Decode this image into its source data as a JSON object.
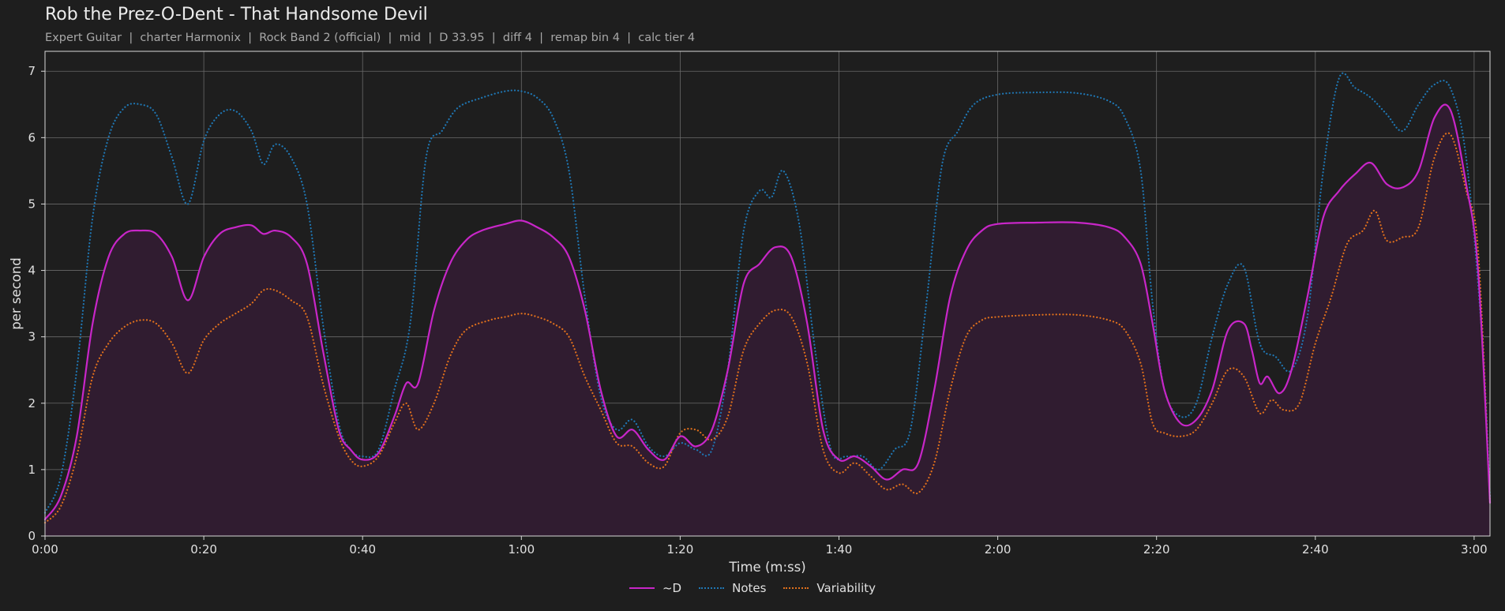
{
  "header": {
    "title": "Rob the Prez-O-Dent - That Handsome Devil",
    "subtitle": "Expert Guitar  |  charter Harmonix  |  Rock Band 2 (official)  |  mid  |  D 33.95  |  diff 4  |  remap bin 4  |  calc tier 4"
  },
  "colors": {
    "background": "#1e1e1e",
    "grid": "#6a6a6a",
    "d": "#c826c8",
    "d_fill": "#301c30",
    "notes": "#1f77b4",
    "variability": "#e0701c"
  },
  "chart_data": {
    "type": "line",
    "xlabel": "Time (m:ss)",
    "ylabel": "per second",
    "xlim": [
      0,
      182
    ],
    "ylim": [
      0,
      7.3
    ],
    "x_ticks": [
      0,
      20,
      40,
      60,
      80,
      100,
      120,
      140,
      160,
      180
    ],
    "x_tick_labels": [
      "0:00",
      "0:20",
      "0:40",
      "1:00",
      "1:20",
      "1:40",
      "2:00",
      "2:20",
      "2:40",
      "3:00"
    ],
    "y_ticks": [
      0,
      1,
      2,
      3,
      4,
      5,
      6,
      7
    ],
    "y_tick_labels": [
      "0",
      "1",
      "2",
      "3",
      "4",
      "5",
      "6",
      "7"
    ],
    "grid": true,
    "legend_position": "bottom-center",
    "series": [
      {
        "name": "~D",
        "style": "solid",
        "filled": true,
        "points": [
          [
            0,
            0.25
          ],
          [
            2,
            0.6
          ],
          [
            4,
            1.5
          ],
          [
            6,
            3.2
          ],
          [
            8,
            4.2
          ],
          [
            10,
            4.55
          ],
          [
            12,
            4.6
          ],
          [
            14,
            4.55
          ],
          [
            16,
            4.2
          ],
          [
            18,
            3.55
          ],
          [
            20,
            4.2
          ],
          [
            22,
            4.55
          ],
          [
            24,
            4.65
          ],
          [
            26,
            4.68
          ],
          [
            27.5,
            4.55
          ],
          [
            29,
            4.6
          ],
          [
            31,
            4.5
          ],
          [
            33,
            4.1
          ],
          [
            35,
            2.8
          ],
          [
            37,
            1.6
          ],
          [
            38.5,
            1.3
          ],
          [
            40,
            1.15
          ],
          [
            42,
            1.25
          ],
          [
            44,
            1.8
          ],
          [
            45.5,
            2.3
          ],
          [
            47,
            2.3
          ],
          [
            49,
            3.4
          ],
          [
            51,
            4.1
          ],
          [
            53,
            4.45
          ],
          [
            55,
            4.6
          ],
          [
            58,
            4.7
          ],
          [
            60,
            4.75
          ],
          [
            62,
            4.65
          ],
          [
            64,
            4.5
          ],
          [
            66,
            4.2
          ],
          [
            68,
            3.4
          ],
          [
            70,
            2.2
          ],
          [
            72,
            1.5
          ],
          [
            74,
            1.6
          ],
          [
            76,
            1.3
          ],
          [
            78,
            1.15
          ],
          [
            80,
            1.5
          ],
          [
            82,
            1.35
          ],
          [
            84,
            1.6
          ],
          [
            86,
            2.5
          ],
          [
            88,
            3.8
          ],
          [
            90,
            4.1
          ],
          [
            92,
            4.35
          ],
          [
            94,
            4.2
          ],
          [
            96,
            3.2
          ],
          [
            98,
            1.6
          ],
          [
            100,
            1.15
          ],
          [
            102,
            1.2
          ],
          [
            104,
            1.05
          ],
          [
            106,
            0.85
          ],
          [
            108,
            1.0
          ],
          [
            110,
            1.1
          ],
          [
            112,
            2.2
          ],
          [
            114,
            3.6
          ],
          [
            116,
            4.3
          ],
          [
            118,
            4.6
          ],
          [
            120,
            4.7
          ],
          [
            125,
            4.72
          ],
          [
            130,
            4.72
          ],
          [
            134,
            4.65
          ],
          [
            136,
            4.5
          ],
          [
            138,
            4.1
          ],
          [
            139.5,
            3.2
          ],
          [
            141,
            2.2
          ],
          [
            143,
            1.7
          ],
          [
            145,
            1.75
          ],
          [
            147,
            2.2
          ],
          [
            149,
            3.1
          ],
          [
            151,
            3.2
          ],
          [
            152,
            2.8
          ],
          [
            153,
            2.3
          ],
          [
            154,
            2.4
          ],
          [
            155.5,
            2.15
          ],
          [
            157,
            2.5
          ],
          [
            159,
            3.6
          ],
          [
            161,
            4.8
          ],
          [
            163,
            5.2
          ],
          [
            165,
            5.45
          ],
          [
            167,
            5.62
          ],
          [
            169,
            5.3
          ],
          [
            171,
            5.25
          ],
          [
            173,
            5.5
          ],
          [
            175,
            6.3
          ],
          [
            177,
            6.42
          ],
          [
            179,
            5.3
          ],
          [
            180.5,
            4.0
          ],
          [
            182,
            0.5
          ]
        ]
      },
      {
        "name": "Notes",
        "style": "dotted",
        "filled": false,
        "points": [
          [
            0,
            0.35
          ],
          [
            2,
            0.9
          ],
          [
            4,
            2.5
          ],
          [
            6,
            4.8
          ],
          [
            8,
            6.0
          ],
          [
            10,
            6.45
          ],
          [
            12,
            6.5
          ],
          [
            14,
            6.35
          ],
          [
            16,
            5.7
          ],
          [
            18,
            5.0
          ],
          [
            20,
            5.95
          ],
          [
            22,
            6.35
          ],
          [
            24,
            6.4
          ],
          [
            26,
            6.1
          ],
          [
            27.5,
            5.6
          ],
          [
            29,
            5.9
          ],
          [
            31,
            5.7
          ],
          [
            33,
            5.0
          ],
          [
            35,
            3.2
          ],
          [
            37,
            1.7
          ],
          [
            38.5,
            1.3
          ],
          [
            40,
            1.2
          ],
          [
            42,
            1.3
          ],
          [
            44,
            2.2
          ],
          [
            46,
            3.2
          ],
          [
            48,
            5.7
          ],
          [
            50,
            6.1
          ],
          [
            52,
            6.45
          ],
          [
            55,
            6.6
          ],
          [
            58,
            6.7
          ],
          [
            60,
            6.7
          ],
          [
            62,
            6.6
          ],
          [
            64,
            6.3
          ],
          [
            66,
            5.5
          ],
          [
            68,
            3.6
          ],
          [
            70,
            2.1
          ],
          [
            72,
            1.6
          ],
          [
            74,
            1.75
          ],
          [
            76,
            1.35
          ],
          [
            78,
            1.2
          ],
          [
            80,
            1.4
          ],
          [
            82,
            1.3
          ],
          [
            84,
            1.3
          ],
          [
            86,
            2.5
          ],
          [
            88,
            4.6
          ],
          [
            90,
            5.2
          ],
          [
            91.5,
            5.1
          ],
          [
            93,
            5.5
          ],
          [
            95,
            4.7
          ],
          [
            97,
            2.8
          ],
          [
            99,
            1.3
          ],
          [
            101,
            1.2
          ],
          [
            103,
            1.2
          ],
          [
            105,
            1.0
          ],
          [
            107,
            1.3
          ],
          [
            109,
            1.6
          ],
          [
            111,
            3.5
          ],
          [
            113,
            5.6
          ],
          [
            115,
            6.1
          ],
          [
            117,
            6.5
          ],
          [
            120,
            6.65
          ],
          [
            125,
            6.68
          ],
          [
            130,
            6.67
          ],
          [
            134,
            6.55
          ],
          [
            136,
            6.3
          ],
          [
            138,
            5.5
          ],
          [
            139.5,
            3.5
          ],
          [
            141,
            2.2
          ],
          [
            143,
            1.8
          ],
          [
            145,
            2.0
          ],
          [
            147,
            3.0
          ],
          [
            149,
            3.8
          ],
          [
            151,
            4.05
          ],
          [
            153,
            2.9
          ],
          [
            155,
            2.7
          ],
          [
            157,
            2.5
          ],
          [
            159,
            3.3
          ],
          [
            161,
            5.5
          ],
          [
            163,
            6.9
          ],
          [
            165,
            6.75
          ],
          [
            167,
            6.6
          ],
          [
            169,
            6.35
          ],
          [
            171,
            6.1
          ],
          [
            173,
            6.5
          ],
          [
            175,
            6.8
          ],
          [
            177,
            6.75
          ],
          [
            179,
            5.7
          ],
          [
            181,
            3.0
          ],
          [
            182,
            0.6
          ]
        ]
      },
      {
        "name": "Variability",
        "style": "dotted",
        "filled": false,
        "points": [
          [
            0,
            0.2
          ],
          [
            2,
            0.45
          ],
          [
            4,
            1.2
          ],
          [
            6,
            2.4
          ],
          [
            8,
            2.9
          ],
          [
            10,
            3.15
          ],
          [
            12,
            3.25
          ],
          [
            14,
            3.2
          ],
          [
            16,
            2.9
          ],
          [
            18,
            2.45
          ],
          [
            20,
            2.95
          ],
          [
            22,
            3.2
          ],
          [
            24,
            3.35
          ],
          [
            26,
            3.5
          ],
          [
            27.5,
            3.7
          ],
          [
            29,
            3.7
          ],
          [
            31,
            3.55
          ],
          [
            33,
            3.3
          ],
          [
            35,
            2.3
          ],
          [
            37,
            1.5
          ],
          [
            38.5,
            1.15
          ],
          [
            40,
            1.05
          ],
          [
            42,
            1.2
          ],
          [
            44,
            1.7
          ],
          [
            45.5,
            2.0
          ],
          [
            47,
            1.6
          ],
          [
            49,
            2.0
          ],
          [
            51,
            2.7
          ],
          [
            53,
            3.1
          ],
          [
            56,
            3.25
          ],
          [
            58,
            3.3
          ],
          [
            60,
            3.35
          ],
          [
            62,
            3.3
          ],
          [
            64,
            3.2
          ],
          [
            66,
            3.0
          ],
          [
            68,
            2.4
          ],
          [
            70,
            1.9
          ],
          [
            72,
            1.4
          ],
          [
            74,
            1.35
          ],
          [
            76,
            1.1
          ],
          [
            78,
            1.05
          ],
          [
            80,
            1.55
          ],
          [
            82,
            1.6
          ],
          [
            84,
            1.45
          ],
          [
            86,
            1.8
          ],
          [
            88,
            2.8
          ],
          [
            90,
            3.2
          ],
          [
            92,
            3.4
          ],
          [
            94,
            3.3
          ],
          [
            96,
            2.6
          ],
          [
            98,
            1.3
          ],
          [
            100,
            0.95
          ],
          [
            102,
            1.1
          ],
          [
            104,
            0.9
          ],
          [
            106,
            0.7
          ],
          [
            108,
            0.78
          ],
          [
            110,
            0.65
          ],
          [
            112,
            1.1
          ],
          [
            114,
            2.2
          ],
          [
            116,
            3.0
          ],
          [
            118,
            3.25
          ],
          [
            120,
            3.3
          ],
          [
            125,
            3.33
          ],
          [
            130,
            3.33
          ],
          [
            134,
            3.25
          ],
          [
            136,
            3.1
          ],
          [
            138,
            2.6
          ],
          [
            139.5,
            1.7
          ],
          [
            141,
            1.55
          ],
          [
            143,
            1.5
          ],
          [
            145,
            1.6
          ],
          [
            147,
            2.0
          ],
          [
            149,
            2.5
          ],
          [
            151,
            2.4
          ],
          [
            153,
            1.85
          ],
          [
            154.5,
            2.05
          ],
          [
            156,
            1.9
          ],
          [
            158,
            2.0
          ],
          [
            160,
            2.9
          ],
          [
            162,
            3.6
          ],
          [
            164,
            4.4
          ],
          [
            166,
            4.6
          ],
          [
            167.5,
            4.9
          ],
          [
            169,
            4.45
          ],
          [
            171,
            4.5
          ],
          [
            173,
            4.65
          ],
          [
            175,
            5.7
          ],
          [
            177,
            6.05
          ],
          [
            179,
            5.2
          ],
          [
            180.5,
            4.3
          ],
          [
            182,
            0.5
          ]
        ]
      }
    ]
  }
}
